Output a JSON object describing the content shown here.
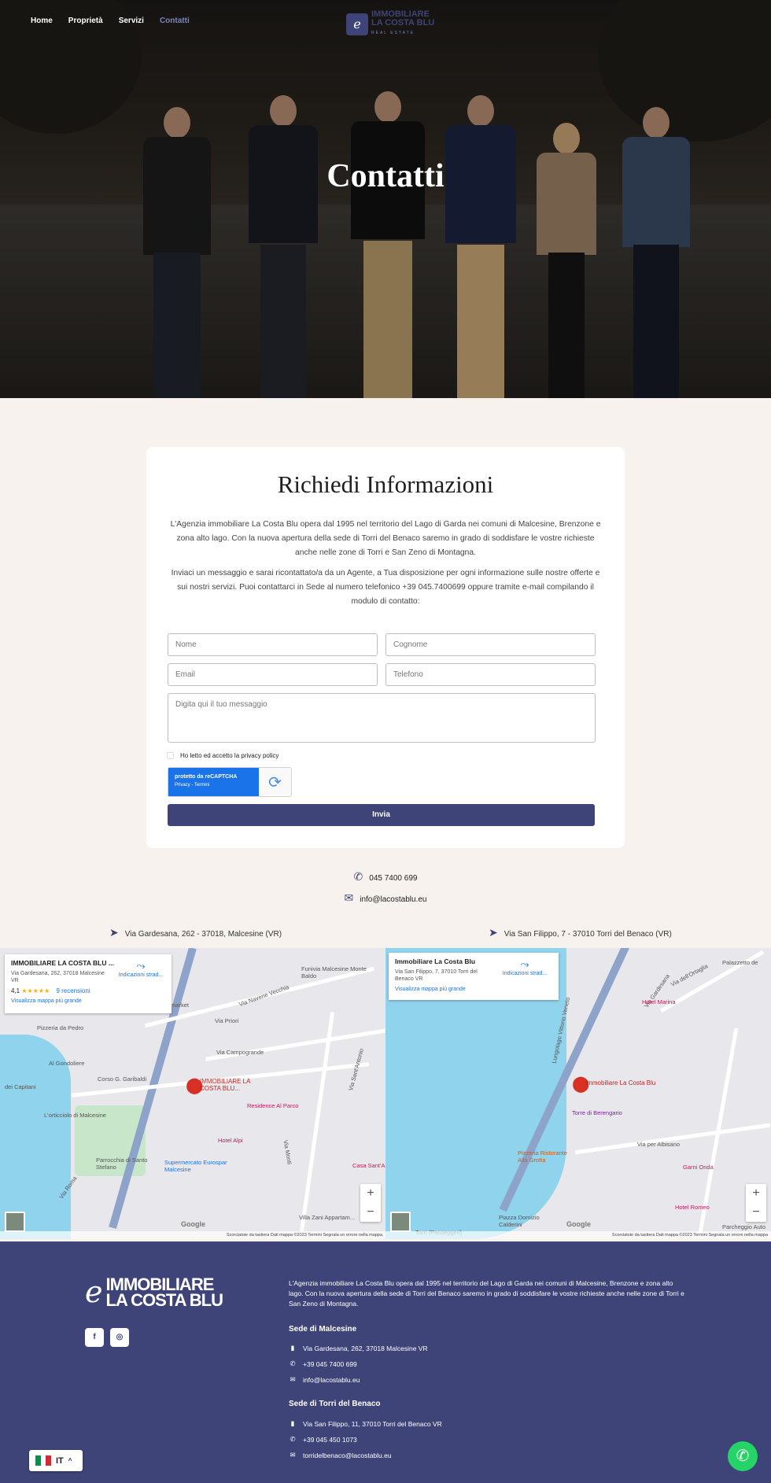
{
  "nav": {
    "items": [
      "Home",
      "Proprietà",
      "Servizi",
      "Contatti"
    ]
  },
  "logo": {
    "line1": "IMMOBILIARE",
    "line2": "LA COSTA BLU",
    "line3": "REAL ESTATE"
  },
  "hero": {
    "title": "Contatti"
  },
  "form": {
    "title": "Richiedi Informazioni",
    "para1": "L'Agenzia immobiliare La Costa Blu opera dal 1995 nel territorio del Lago di Garda nei comuni di Malcesine, Brenzone e zona alto lago. Con la nuova apertura della sede di Torri del Benaco saremo in grado di soddisfare le vostre richieste anche nelle zone di Torri e San Zeno di Montagna.",
    "para2": "Inviaci un messaggio e sarai ricontattato/a da un Agente, a Tua disposizione per ogni informazione sulle nostre offerte e sui nostri servizi. Puoi contattarci in Sede al numero telefonico +39 045.7400699 oppure tramite e-mail compilando il modulo di contatto:",
    "nome": "Nome",
    "cognome": "Cognome",
    "email": "Email",
    "telefono": "Telefono",
    "messaggio": "Digita qui il tuo messaggio",
    "privacy": "Ho letto ed accetto la privacy policy",
    "captcha_title": "protetto da reCAPTCHA",
    "captcha_links": "Privacy - Termini",
    "submit": "Invia"
  },
  "contacts": {
    "phone": "045 7400 699",
    "email": "info@lacostablu.eu"
  },
  "addresses": {
    "malcesine": "Via Gardesana, 262 - 37018, Malcesine (VR)",
    "torri": "Via San Filippo, 7 - 37010 Torri del Benaco (VR)"
  },
  "map1": {
    "name": "IMMOBILIARE LA COSTA BLU ...",
    "address": "Via Gardesana, 262, 37018 Malcesine VR",
    "rating": "4,1",
    "stars": "★★★★★",
    "reviews": "9 recensioni",
    "directions": "Indicazioni strad...",
    "bigmap": "Visualizza mappa più grande",
    "pin": "IMMOBILIARE LA COSTA BLU...",
    "pois": [
      "Pizzeria da Pedro",
      "Al Gondoliere",
      "Corso G. Garibaldi",
      "Via Priori",
      "Via Campogrande",
      "Funivia Malcesine Monte Baldo",
      "Despar supermarket",
      "Residence Al Parco",
      "Hotel Alpi",
      "Supermercato Eurospar Malcesine",
      "Parrocchia di Santo Stefano",
      "L'orticciolo di Malcesine",
      "Casa Sant'A",
      "Villa Zani Appartam...",
      "Via Navene Vecchia",
      "Via Sant'Antonio",
      "Via Monti",
      "Via Roma",
      "dei Capitani"
    ],
    "footer": "Scorciatoie da tastiera   Dati mappa ©2023   Termini   Segnala un errore nella mappa"
  },
  "map2": {
    "name": "Immobiliare La Costa Blu",
    "address": "Via San Filippo, 7, 37010 Torri del Benaco VR",
    "directions": "Indicazioni strad...",
    "bigmap": "Visualizza mappa più grande",
    "pin": "Immobiliare La Costa Blu",
    "pois": [
      "Hotel Marina",
      "Torre di Berengario",
      "Via per Albisano",
      "Garni Onda",
      "Hotel Romeo",
      "Parcheggio Auto",
      "Piazza Domizio Calderini",
      "Torri (Passeggeri)",
      "Lungolago Vittorio Veneto",
      "Via dell'Ortaglia",
      "Pizzeria Ristorante Alla Grotta",
      "Via Gardesana",
      "Palazzetto de"
    ],
    "footer": "Scorciatoie da tastiera   Dati mappa ©2023   Termini   Segnala un errore nella mappa"
  },
  "footer": {
    "logo_l1": "IMMOBILIARE",
    "logo_l2": "LA COSTA BLU",
    "desc": "L'Agenzia immobiliare La Costa Blu opera dal 1995 nel territorio del Lago di Garda nei comuni di Malcesine, Brenzone e zona alto lago. Con la nuova apertura della sede di Torri del Benaco saremo in grado di soddisfare le vostre richieste anche nelle zone di Torri e San Zeno di Montagna.",
    "sede1": "Sede di Malcesine",
    "sede1_addr": "Via Gardesana, 262, 37018 Malcesine VR",
    "sede1_phone": "+39 045 7400 699",
    "sede1_email": "info@lacostablu.eu",
    "sede2": "Sede di Torri del Benaco",
    "sede2_addr": "Via San Filippo, 11, 37010 Torri del Benaco VR",
    "sede2_phone": "+39 045 450 1073",
    "sede2_email": "torridelbenaco@lacostablu.eu"
  },
  "lang": {
    "code": "IT"
  },
  "colors": {
    "brand": "#3e4478",
    "accent": "#7a85c2",
    "whatsapp": "#25d366"
  }
}
